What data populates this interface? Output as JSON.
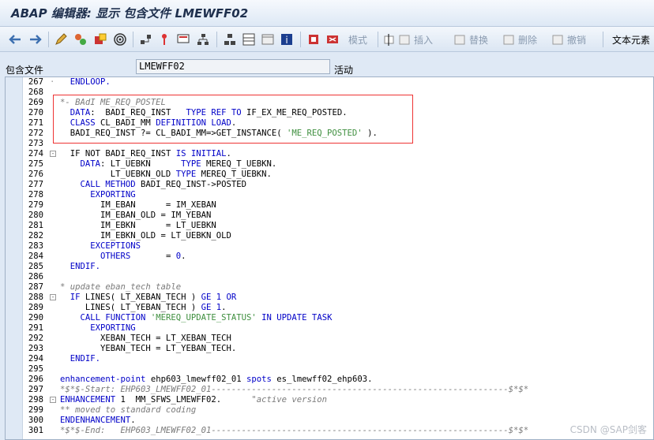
{
  "window": {
    "title": "ABAP 编辑器: 显示 包含文件 LMEWFF02"
  },
  "toolbar": {
    "pattern_label": "模式",
    "insert_label": "插入",
    "replace_label": "替换",
    "delete_label": "删除",
    "undo_label": "撤销",
    "text_elements_label": "文本元素"
  },
  "field": {
    "label": "包含文件",
    "value": "LMEWFF02",
    "status": "活动"
  },
  "watermark": "CSDN @SAP剑客",
  "lines": [
    {
      "n": "267",
      "m": "dot",
      "c": [
        [
          "  ENDLOOP.",
          "kw"
        ]
      ]
    },
    {
      "n": "268",
      "m": "",
      "c": []
    },
    {
      "n": "269",
      "m": "",
      "c": [
        [
          "*- BAdI ME_REQ_POSTEL",
          "cm"
        ]
      ]
    },
    {
      "n": "270",
      "m": "",
      "c": [
        [
          "  DATA",
          "kw"
        ],
        [
          ":  BADI_REQ_INST   ",
          ""
        ],
        [
          "TYPE REF TO",
          "kw"
        ],
        [
          " IF_EX_ME_REQ_POSTED.",
          ""
        ]
      ]
    },
    {
      "n": "271",
      "m": "",
      "c": [
        [
          "  CLASS",
          "kw"
        ],
        [
          " CL_BADI_MM ",
          ""
        ],
        [
          "DEFINITION LOAD",
          "kw"
        ],
        [
          ".",
          ""
        ]
      ]
    },
    {
      "n": "272",
      "m": "",
      "c": [
        [
          "  BADI_REQ_INST ?= CL_BADI_MM=>GET_INSTANCE( ",
          ""
        ],
        [
          "'ME_REQ_POSTED'",
          "st"
        ],
        [
          " ).",
          ""
        ]
      ]
    },
    {
      "n": "273",
      "m": "",
      "c": []
    },
    {
      "n": "274",
      "m": "box",
      "c": [
        [
          "  IF NOT",
          ""
        ],
        [
          " BADI_REQ_INST ",
          ""
        ],
        [
          "IS INITIAL",
          "kw"
        ],
        [
          ".",
          ""
        ]
      ]
    },
    {
      "n": "275",
      "m": "",
      "c": [
        [
          "    DATA",
          "kw"
        ],
        [
          ": LT_UEBKN      ",
          ""
        ],
        [
          "TYPE",
          "kw"
        ],
        [
          " MEREQ_T_UEBKN.",
          ""
        ]
      ]
    },
    {
      "n": "276",
      "m": "",
      "c": [
        [
          "          LT_UEBKN_OLD ",
          ""
        ],
        [
          "TYPE",
          "kw"
        ],
        [
          " MEREQ_T_UEBKN.",
          ""
        ]
      ]
    },
    {
      "n": "277",
      "m": "",
      "c": [
        [
          "    CALL METHOD",
          "kw"
        ],
        [
          " BADI_REQ_INST->POSTED",
          ""
        ]
      ]
    },
    {
      "n": "278",
      "m": "",
      "c": [
        [
          "      EXPORTING",
          "kw"
        ]
      ]
    },
    {
      "n": "279",
      "m": "",
      "c": [
        [
          "        IM_EBAN      = IM_XEBAN",
          ""
        ]
      ]
    },
    {
      "n": "280",
      "m": "",
      "c": [
        [
          "        IM_EBAN_OLD = IM_YEBAN",
          ""
        ]
      ]
    },
    {
      "n": "281",
      "m": "",
      "c": [
        [
          "        IM_EBKN      = LT_UEBKN",
          ""
        ]
      ]
    },
    {
      "n": "282",
      "m": "",
      "c": [
        [
          "        IM_EBKN_OLD = LT_UEBKN_OLD",
          ""
        ]
      ]
    },
    {
      "n": "283",
      "m": "",
      "c": [
        [
          "      EXCEPTIONS",
          "kw"
        ]
      ]
    },
    {
      "n": "284",
      "m": "",
      "c": [
        [
          "        OTHERS",
          "kw"
        ],
        [
          "       = ",
          ""
        ],
        [
          "0",
          "nu"
        ],
        [
          ".",
          ""
        ]
      ]
    },
    {
      "n": "285",
      "m": "",
      "c": [
        [
          "  ENDIF.",
          "kw"
        ]
      ]
    },
    {
      "n": "286",
      "m": "",
      "c": []
    },
    {
      "n": "287",
      "m": "",
      "c": [
        [
          "* update eban_tech table",
          "cm"
        ]
      ]
    },
    {
      "n": "288",
      "m": "box",
      "c": [
        [
          "  IF",
          "kw"
        ],
        [
          " LINES( LT_XEBAN_TECH ) ",
          ""
        ],
        [
          "GE",
          "kw"
        ],
        [
          " ",
          ""
        ],
        [
          "1",
          "nu"
        ],
        [
          " ",
          ""
        ],
        [
          "OR",
          "kw"
        ]
      ]
    },
    {
      "n": "289",
      "m": "",
      "c": [
        [
          "     LINES( LT_YEBAN_TECH ) ",
          ""
        ],
        [
          "GE",
          "kw"
        ],
        [
          " ",
          ""
        ],
        [
          "1",
          "nu"
        ],
        [
          ".",
          ""
        ]
      ]
    },
    {
      "n": "290",
      "m": "",
      "c": [
        [
          "    CALL FUNCTION",
          "kw"
        ],
        [
          " ",
          ""
        ],
        [
          "'MEREQ_UPDATE_STATUS'",
          "st"
        ],
        [
          " ",
          ""
        ],
        [
          "IN UPDATE TASK",
          "kw"
        ]
      ]
    },
    {
      "n": "291",
      "m": "",
      "c": [
        [
          "      EXPORTING",
          "kw"
        ]
      ]
    },
    {
      "n": "292",
      "m": "",
      "c": [
        [
          "        XEBAN_TECH = LT_XEBAN_TECH",
          ""
        ]
      ]
    },
    {
      "n": "293",
      "m": "",
      "c": [
        [
          "        YEBAN_TECH = LT_YEBAN_TECH.",
          ""
        ]
      ]
    },
    {
      "n": "294",
      "m": "",
      "c": [
        [
          "  ENDIF.",
          "kw"
        ]
      ]
    },
    {
      "n": "295",
      "m": "",
      "c": []
    },
    {
      "n": "296",
      "m": "",
      "c": [
        [
          "enhancement-point",
          "kw"
        ],
        [
          " ehp603_lmewff02_01 ",
          ""
        ],
        [
          "spots",
          "kw"
        ],
        [
          " es_lmewff02_ehp603.",
          ""
        ]
      ]
    },
    {
      "n": "297",
      "m": "",
      "c": [
        [
          "*$*$-Start: EHP603_LMEWFF02_01-----------------------------------------------------------$*$*",
          "cm"
        ]
      ]
    },
    {
      "n": "298",
      "m": "box",
      "c": [
        [
          "ENHANCEMENT",
          "kw"
        ],
        [
          " 1  MM_SFWS_LMEWFF02.      ",
          ""
        ],
        [
          "\"active version",
          "cm"
        ]
      ]
    },
    {
      "n": "299",
      "m": "",
      "c": [
        [
          "** moved to standard coding",
          "cm"
        ]
      ]
    },
    {
      "n": "300",
      "m": "",
      "c": [
        [
          "ENDENHANCEMENT",
          "kw"
        ],
        [
          ".",
          ""
        ]
      ]
    },
    {
      "n": "301",
      "m": "",
      "c": [
        [
          "*$*$-End:   EHP603_LMEWFF02_01-----------------------------------------------------------$*$*",
          "cm"
        ]
      ]
    }
  ]
}
